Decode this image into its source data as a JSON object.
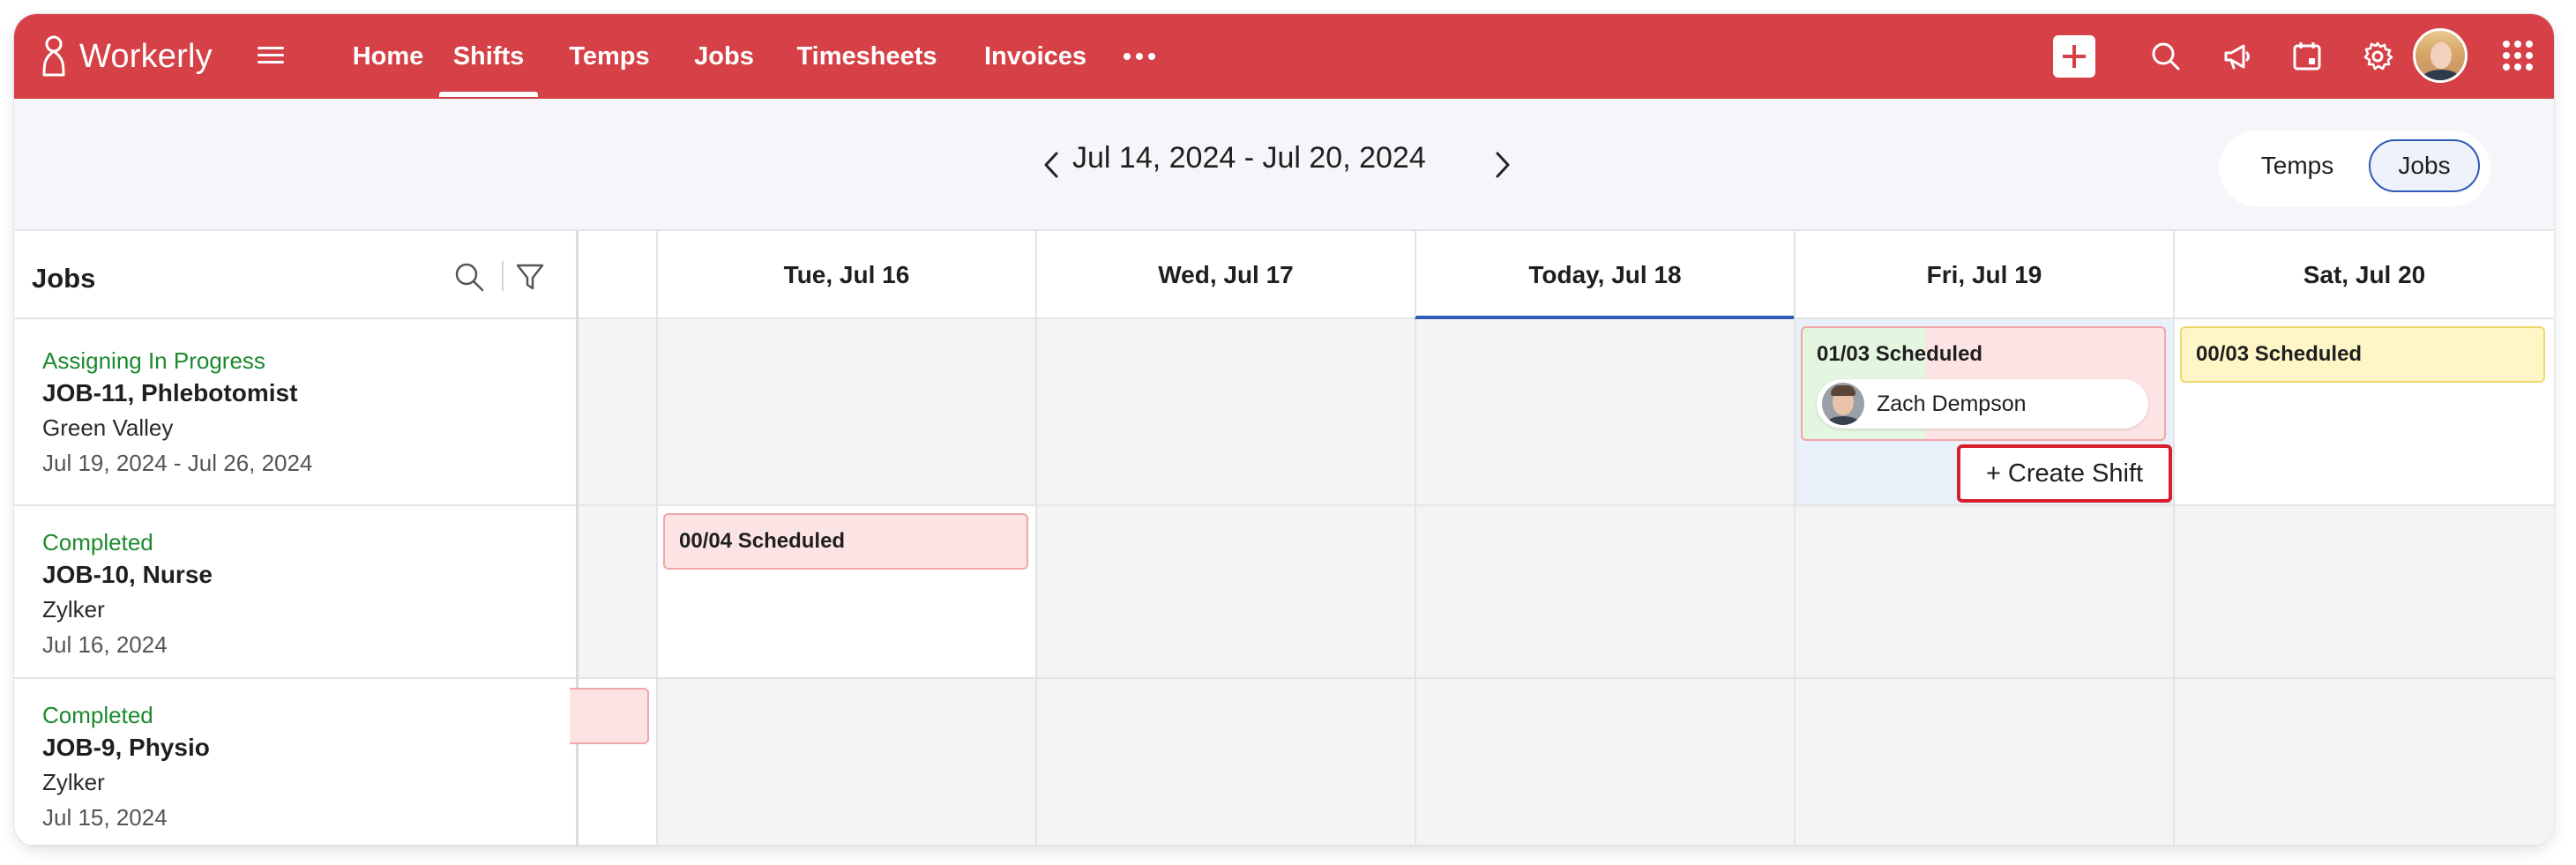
{
  "app": {
    "name": "Workerly"
  },
  "nav": {
    "items": [
      {
        "label": "Home",
        "active": false
      },
      {
        "label": "Shifts",
        "active": true
      },
      {
        "label": "Temps",
        "active": false
      },
      {
        "label": "Jobs",
        "active": false
      },
      {
        "label": "Timesheets",
        "active": false
      },
      {
        "label": "Invoices",
        "active": false
      }
    ],
    "icons": [
      "more-icon",
      "add-icon",
      "search-icon",
      "announcement-icon",
      "calendar-icon",
      "settings-icon",
      "avatar",
      "apps-icon"
    ]
  },
  "datebar": {
    "range": "Jul 14, 2024 - Jul 20, 2024",
    "view_toggle": {
      "options": [
        "Temps",
        "Jobs"
      ],
      "selected": "Jobs"
    }
  },
  "jobs_panel": {
    "title": "Jobs",
    "jobs": [
      {
        "status": "Assigning In Progress",
        "title": "JOB-11, Phlebotomist",
        "client": "Green Valley",
        "dates": "Jul 19, 2024 - Jul 26, 2024"
      },
      {
        "status": "Completed",
        "title": "JOB-10, Nurse",
        "client": "Zylker",
        "dates": "Jul 16, 2024"
      },
      {
        "status": "Completed",
        "title": "JOB-9, Physio",
        "client": "Zylker",
        "dates": "Jul 15, 2024"
      }
    ]
  },
  "calendar": {
    "days": [
      {
        "label": "Tue, Jul 16",
        "today": false
      },
      {
        "label": "Wed, Jul 17",
        "today": false
      },
      {
        "label": "Today, Jul 18",
        "today": true
      },
      {
        "label": "Fri, Jul 19",
        "today": false
      },
      {
        "label": "Sat, Jul 20",
        "today": false
      }
    ],
    "shifts": [
      {
        "job": "JOB-11, Phlebotomist",
        "day": "Fri, Jul 19",
        "label": "01/03 Scheduled",
        "assignee": "Zach Dempson"
      },
      {
        "job": "JOB-11, Phlebotomist",
        "day": "Sat, Jul 20",
        "label": "00/03 Scheduled"
      },
      {
        "job": "JOB-10, Nurse",
        "day": "Tue, Jul 16",
        "label": "00/04 Scheduled"
      }
    ],
    "create_shift_label": "+ Create Shift"
  },
  "colors": {
    "brand": "#d64148",
    "status_green": "#1b8a2e",
    "today_underline": "#2d5bb6",
    "highlight": "#d81e2c"
  }
}
